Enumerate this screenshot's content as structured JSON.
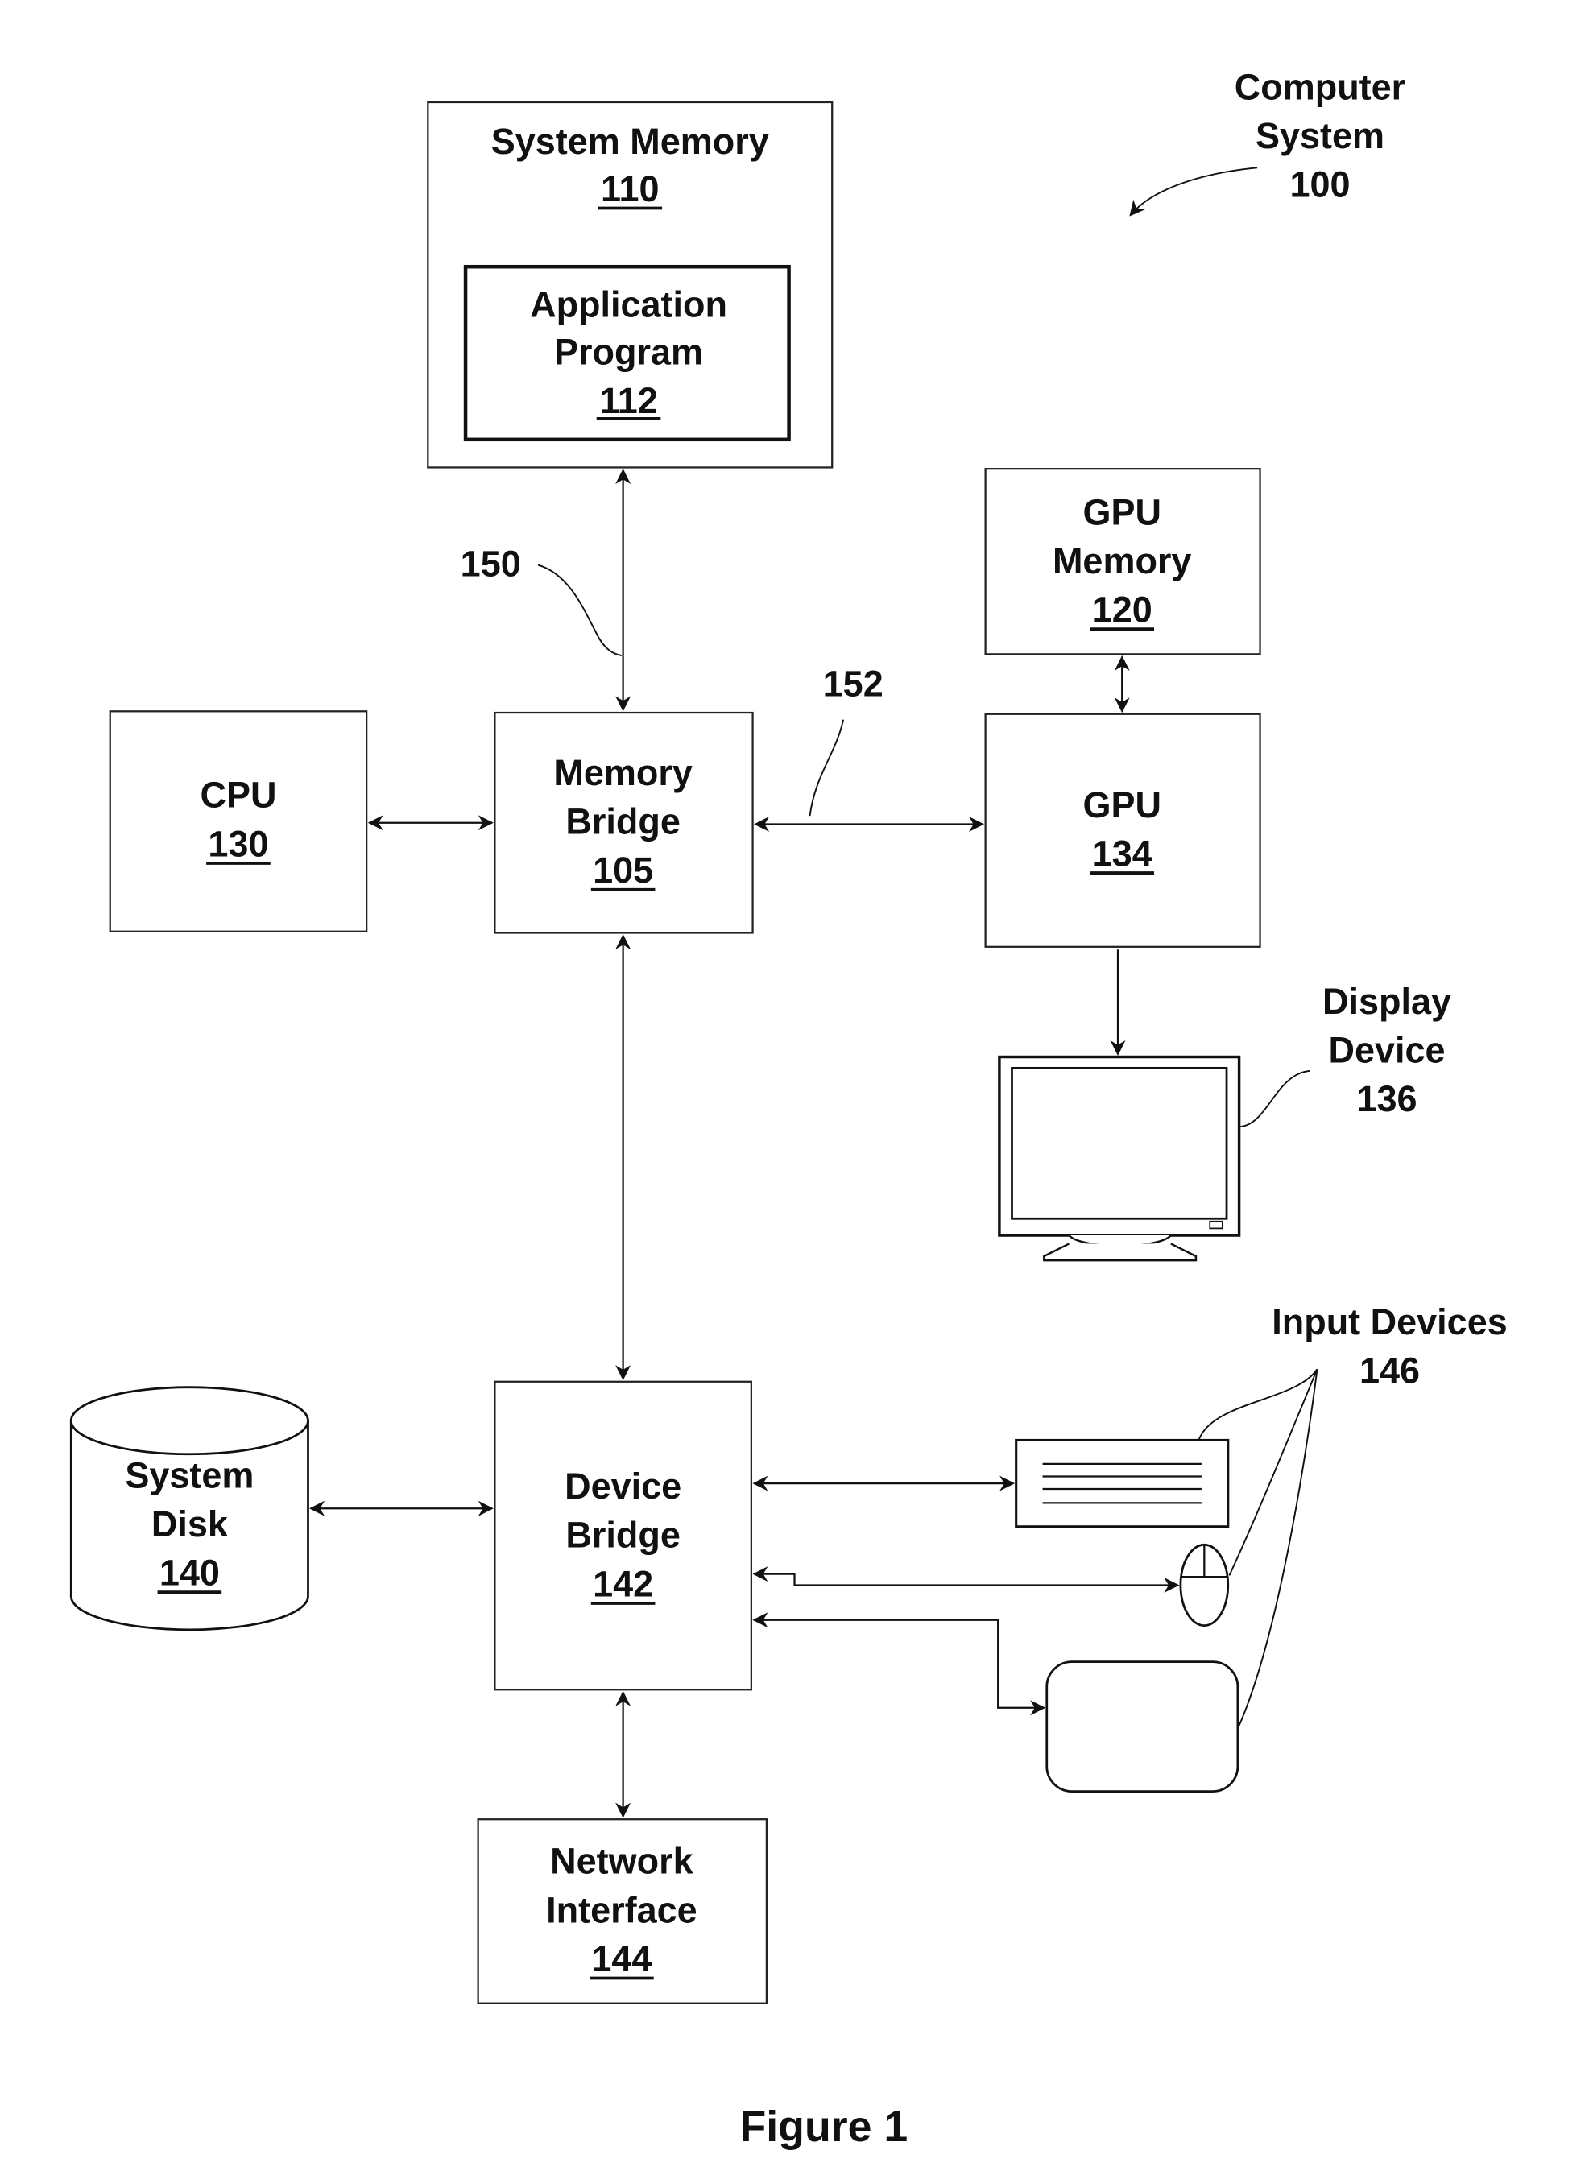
{
  "figure": {
    "caption": "Figure 1",
    "system": {
      "name_line1": "Computer",
      "name_line2": "System",
      "ref": "100"
    },
    "blocks": {
      "system_memory": {
        "line1": "System Memory",
        "ref": "110"
      },
      "application_program": {
        "line1": "Application",
        "line2": "Program",
        "ref": "112"
      },
      "gpu_memory": {
        "line1": "GPU",
        "line2": "Memory",
        "ref": "120"
      },
      "cpu": {
        "line1": "CPU",
        "ref": "130"
      },
      "memory_bridge": {
        "line1": "Memory",
        "line2": "Bridge",
        "ref": "105"
      },
      "gpu": {
        "line1": "GPU",
        "ref": "134"
      },
      "system_disk": {
        "line1": "System",
        "line2": "Disk",
        "ref": "140"
      },
      "device_bridge": {
        "line1": "Device",
        "line2": "Bridge",
        "ref": "142"
      },
      "network_interface": {
        "line1": "Network",
        "line2": "Interface",
        "ref": "144"
      }
    },
    "callouts": {
      "bus_150": "150",
      "bus_152": "152",
      "display_device": {
        "line1": "Display",
        "line2": "Device",
        "ref": "136"
      },
      "input_devices": {
        "line1": "Input Devices",
        "ref": "146"
      }
    }
  }
}
